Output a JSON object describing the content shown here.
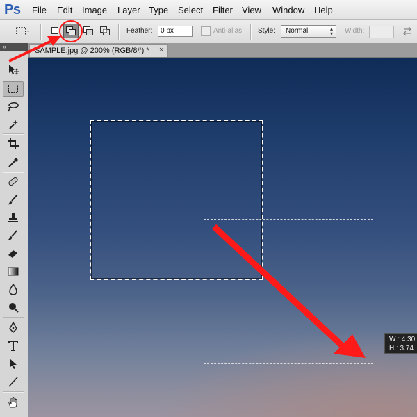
{
  "app": {
    "logo": "Ps"
  },
  "menu": {
    "items": [
      "File",
      "Edit",
      "Image",
      "Layer",
      "Type",
      "Select",
      "Filter",
      "View",
      "Window",
      "Help"
    ]
  },
  "options": {
    "feather_label": "Feather:",
    "feather_value": "0 px",
    "antialias_label": "Anti-alias",
    "style_label": "Style:",
    "style_value": "Normal",
    "width_label": "Width:"
  },
  "document_tab": {
    "title": "SAMPLE.jpg @ 200% (RGB/8#) *",
    "close": "×"
  },
  "tools_panel": {
    "collapse": "»"
  },
  "dimensions": {
    "w": "W : 4.30",
    "h": "H : 3.74"
  },
  "annotation": {
    "color": "#ff1a1a"
  },
  "icons": [
    "marquee-tool-icon",
    "new-selection-icon",
    "add-to-selection-icon",
    "subtract-selection-icon",
    "intersect-selection-icon",
    "swap-icon",
    "move-tool-icon",
    "lasso-tool-icon",
    "quick-select-icon",
    "crop-tool-icon",
    "eyedropper-icon",
    "healing-brush-icon",
    "brush-icon",
    "stamp-icon",
    "history-brush-icon",
    "eraser-icon",
    "gradient-icon",
    "blur-icon",
    "dodge-icon",
    "pen-icon",
    "type-icon",
    "path-select-icon",
    "line-icon",
    "hand-icon"
  ]
}
